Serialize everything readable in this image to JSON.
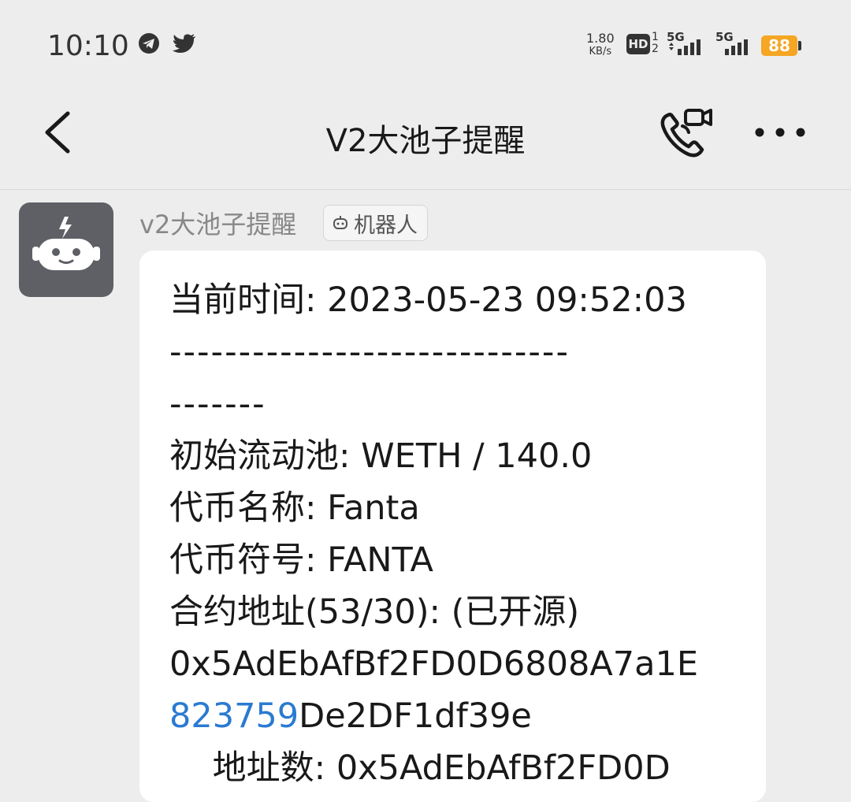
{
  "status_bar": {
    "time": "10:10",
    "net_speed_value": "1.80",
    "net_speed_unit": "KB/s",
    "hd_label": "HD",
    "hd_sub_top": "1",
    "hd_sub_bottom": "2",
    "signal_1_label": "5G",
    "signal_2_label": "5G",
    "battery": "88",
    "icons": [
      "telegram-icon",
      "twitter-icon"
    ]
  },
  "nav": {
    "title": "V2大池子提醒",
    "icons": [
      "back-chevron-icon",
      "video-call-icon",
      "more-icon"
    ]
  },
  "message": {
    "sender": "v2大池子提醒",
    "badge": "机器人",
    "lines": {
      "time": "当前时间: 2023-05-23 09:52:03",
      "divider1": "-----------------------------",
      "divider2": "-------",
      "pool": "初始流动池: WETH / 140.0",
      "token_name": "代币名称: Fanta",
      "token_symbol": "代币符号: FANTA",
      "contract": "合约地址(53/30): (已开源)",
      "address_line1": "0x5AdEbAfBf2FD0D6808A7a1E",
      "address_link": "823759",
      "address_rest": "De2DF1df39e",
      "partial": "    地址数: 0x5AdEbAfBf2FD0D"
    }
  },
  "colors": {
    "background": "#ededed",
    "bubble": "#ffffff",
    "link": "#2a7ad1",
    "battery": "#f5a623",
    "avatar": "#5e6066"
  }
}
